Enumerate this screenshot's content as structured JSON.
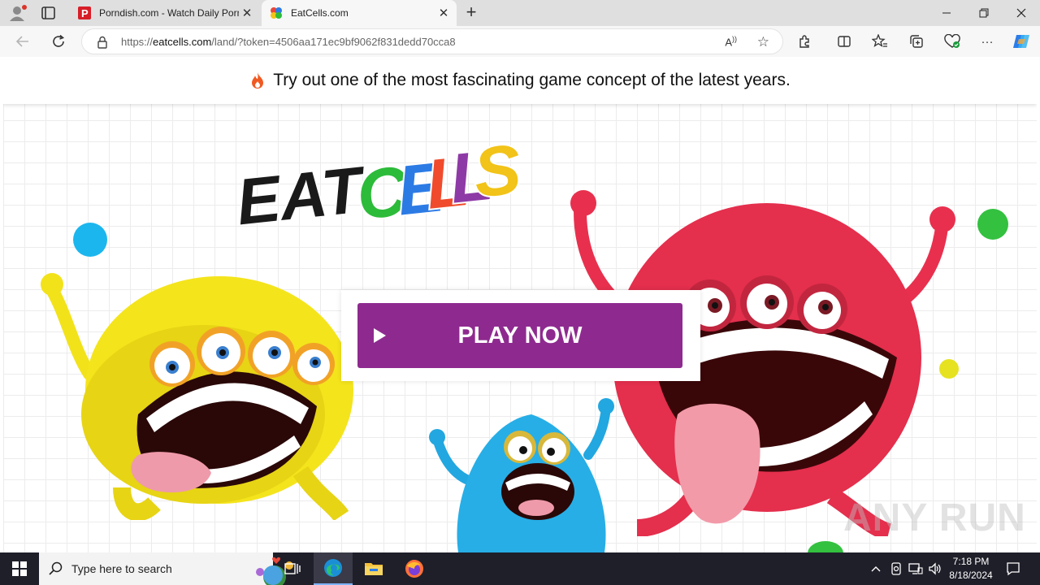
{
  "browser": {
    "tabs": [
      {
        "title": "Porndish.com - Watch Daily Porn",
        "favicon": "porndish-p-icon",
        "active": false
      },
      {
        "title": "EatCells.com",
        "favicon": "eatcells-icon",
        "active": true
      }
    ],
    "address": {
      "protocol": "https://",
      "domain": "eatcells.com",
      "path": "/land/?token=4506aa171ec9bf9062f831dedd70cca8"
    },
    "read_aloud_label": "A",
    "icons": [
      "back-icon",
      "refresh-icon",
      "lock-icon",
      "read-aloud-icon",
      "favorite-star-icon",
      "extensions-icon",
      "split-screen-icon",
      "favorites-icon",
      "collections-icon",
      "browser-essentials-icon",
      "more-icon",
      "copilot-icon"
    ]
  },
  "page": {
    "banner_text": "Try out one of the most fascinating game concept of the latest years.",
    "logo": {
      "word1": "EAT",
      "word2_letters": [
        "C",
        "E",
        "L",
        "L",
        "S"
      ],
      "word2_colors": [
        "#2dbb3a",
        "#2c7be5",
        "#f04b2c",
        "#8e3aa6",
        "#f2c318"
      ]
    },
    "play_button_label": "PLAY NOW",
    "play_button_color": "#8e2a8f",
    "watermark": "ANY RUN"
  },
  "taskbar": {
    "search_placeholder": "Type here to search",
    "time": "7:18 PM",
    "date": "8/18/2024",
    "pinned": [
      "task-view-icon",
      "edge-icon",
      "file-explorer-icon",
      "firefox-icon"
    ]
  }
}
